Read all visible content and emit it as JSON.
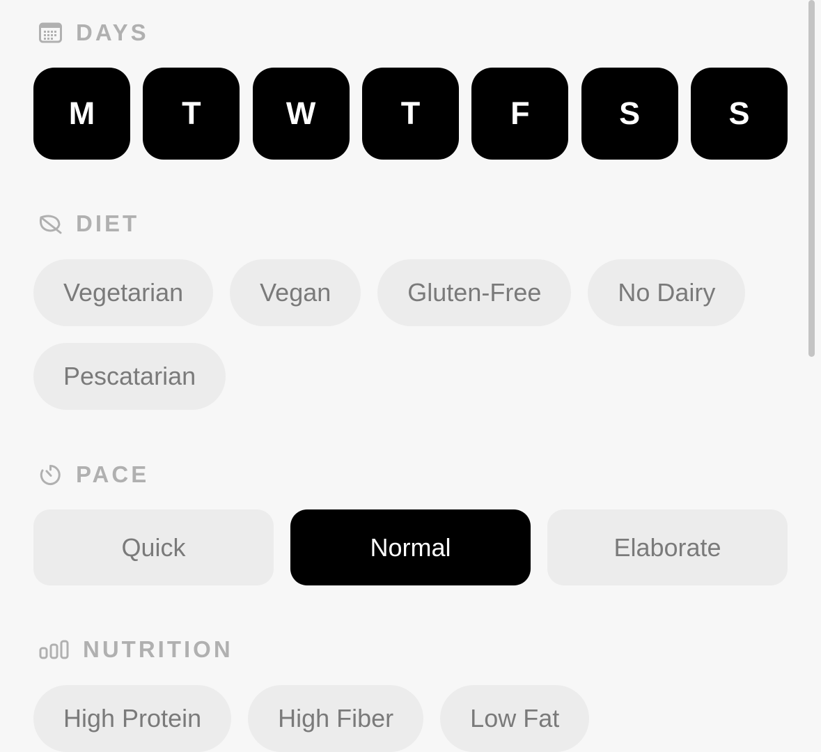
{
  "days": {
    "title": "DAYS",
    "icon": "calendar-icon",
    "items": [
      {
        "label": "M",
        "selected": true
      },
      {
        "label": "T",
        "selected": true
      },
      {
        "label": "W",
        "selected": true
      },
      {
        "label": "T",
        "selected": true
      },
      {
        "label": "F",
        "selected": true
      },
      {
        "label": "S",
        "selected": true
      },
      {
        "label": "S",
        "selected": true
      }
    ]
  },
  "diet": {
    "title": "DIET",
    "icon": "leaf-icon",
    "options": [
      "Vegetarian",
      "Vegan",
      "Gluten-Free",
      "No Dairy",
      "Pescatarian"
    ]
  },
  "pace": {
    "title": "PACE",
    "icon": "timer-icon",
    "options": [
      "Quick",
      "Normal",
      "Elaborate"
    ],
    "selected": "Normal"
  },
  "nutrition": {
    "title": "NUTRITION",
    "icon": "bar-chart-icon",
    "options": [
      "High Protein",
      "High Fiber",
      "Low Fat"
    ]
  },
  "colors": {
    "background": "#f7f7f7",
    "selected": "#000000",
    "chip": "#ececec",
    "chip_text": "#7a7a7a",
    "header_text": "#b0b0b0"
  }
}
